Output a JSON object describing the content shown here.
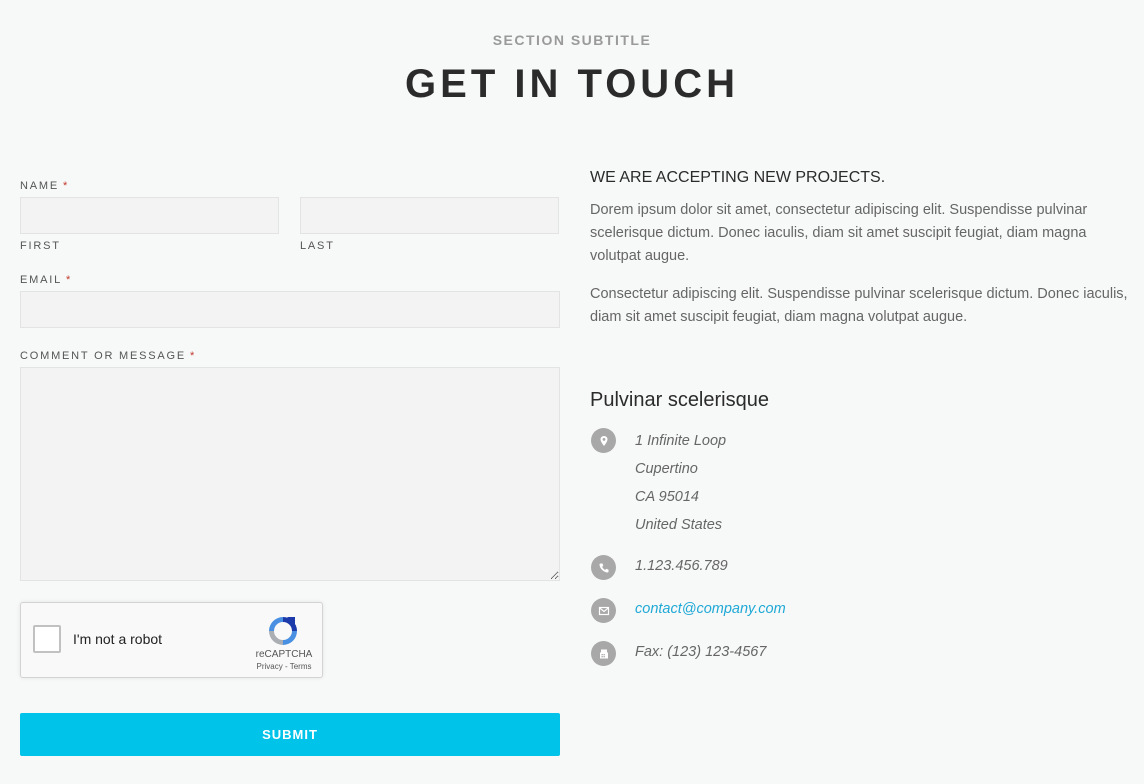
{
  "header": {
    "subtitle": "SECTION SUBTITLE",
    "title": "GET IN TOUCH"
  },
  "form": {
    "name_label": "NAME",
    "required_marker": "*",
    "first_label": "FIRST",
    "last_label": "LAST",
    "first_value": "",
    "last_value": "",
    "email_label": "EMAIL",
    "email_value": "",
    "message_label": "COMMENT OR MESSAGE",
    "message_value": "",
    "submit_label": "SUBMIT"
  },
  "captcha": {
    "label": "I'm not a robot",
    "brand": "reCAPTCHA",
    "privacy": "Privacy",
    "separator": " - ",
    "terms": "Terms",
    "checked": false
  },
  "info": {
    "heading": "WE ARE ACCEPTING NEW PROJECTS.",
    "paragraph1": "Dorem ipsum dolor sit amet, consectetur adipiscing elit. Suspendisse pulvinar scelerisque dictum. Donec iaculis, diam sit amet suscipit feugiat, diam magna volutpat augue.",
    "paragraph2": "Consectetur adipiscing elit. Suspendisse pulvinar scelerisque dictum. Donec iaculis, diam sit amet suscipit feugiat, diam magna volutpat augue.",
    "company": "Pulvinar scelerisque",
    "address": [
      "1 Infinite Loop",
      "Cupertino",
      "CA 95014",
      "United States"
    ],
    "phone": "1.123.456.789",
    "email": "contact@company.com",
    "fax": "Fax: (123) 123-4567"
  },
  "colors": {
    "accent": "#00c3ea",
    "link": "#1fa9d6",
    "required": "#c0392b",
    "icon_bg": "#a8a8a8"
  },
  "icons": {
    "address": "map-pin-icon",
    "phone": "phone-icon",
    "email": "envelope-icon",
    "fax": "fax-icon"
  }
}
